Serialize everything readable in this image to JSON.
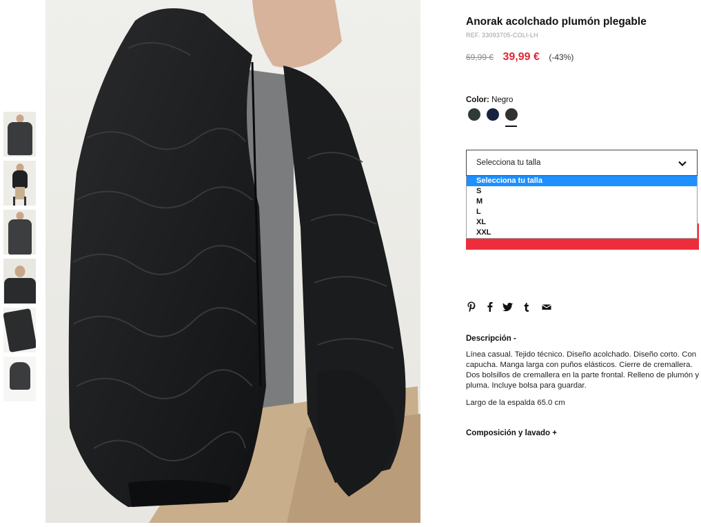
{
  "product": {
    "title": "Anorak acolchado plumón plegable",
    "ref": "REF. 33093705-COLI-LH",
    "price_old": "69,99 €",
    "price_new": "39,99 €",
    "discount": "(-43%)"
  },
  "color": {
    "label": "Color:",
    "value": "Negro",
    "swatches": [
      {
        "name": "swatch-dark-green",
        "color": "#2e3b38"
      },
      {
        "name": "swatch-navy",
        "color": "#17233f"
      },
      {
        "name": "swatch-black",
        "color": "#313131",
        "selected": true
      }
    ]
  },
  "size": {
    "label": "Selecciona tu talla",
    "options": [
      "Selecciona tu talla",
      "S",
      "M",
      "L",
      "XL",
      "XXL"
    ],
    "selected": "Selecciona tu talla"
  },
  "social": [
    "pinterest-icon",
    "facebook-icon",
    "twitter-icon",
    "tumblr-icon",
    "email-icon"
  ],
  "description": {
    "heading": "Descripción -",
    "text": "Línea casual. Tejido técnico. Diseño acolchado. Diseño corto. Con capucha. Manga larga con puños elásticos. Cierre de cremallera. Dos bolsillos de cremallera en la parte frontal. Relleno de plumón y pluma. Incluye bolsa para guardar.",
    "length": "Largo de la espalda 65.0 cm"
  },
  "composition": {
    "heading": "Composición y lavado +"
  },
  "colors": {
    "accent_red": "#ee2d3c",
    "price_red": "#e02535",
    "select_blue": "#1e90ff"
  }
}
